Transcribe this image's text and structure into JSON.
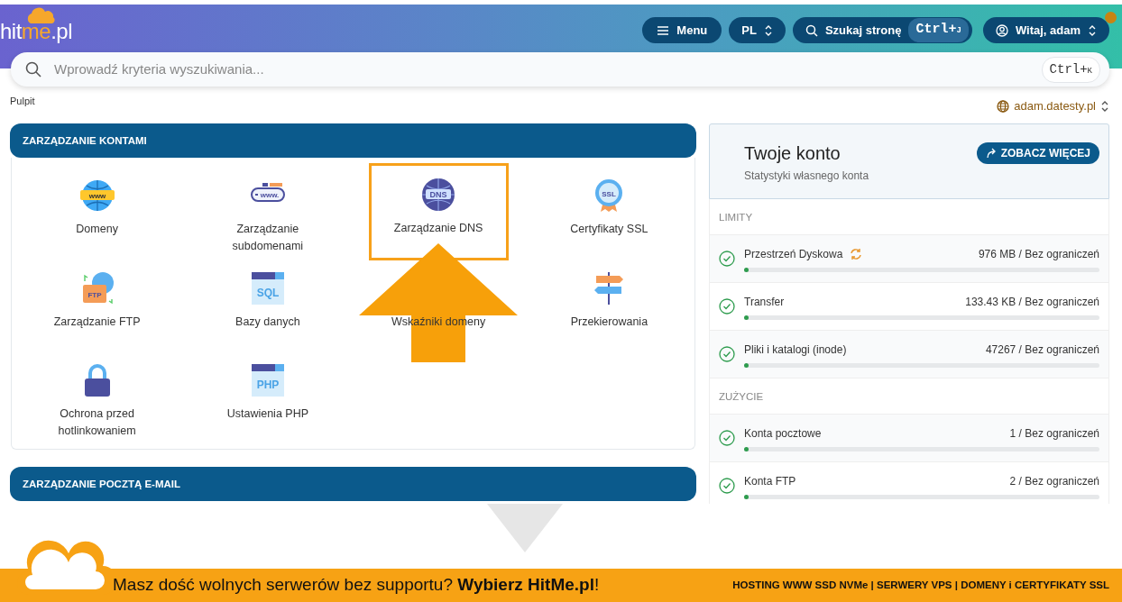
{
  "header": {
    "logo": {
      "text": "hit",
      "accent": "me",
      "suffix": ".pl"
    },
    "menu_button": "Menu",
    "language": "PL",
    "site_search": {
      "label": "Szukaj stronę",
      "shortcut": "Ctrl+",
      "key": "J"
    },
    "user_button": "Witaj, adam",
    "notification": true
  },
  "search": {
    "placeholder": "Wprowadź kryteria wyszukiwania...",
    "shortcut": "Ctrl+",
    "key": "K"
  },
  "breadcrumb": "Pulpit",
  "domain": "adam.datesty.pl",
  "sections": [
    {
      "title": "ZARZĄDZANIE KONTAMI",
      "items": [
        {
          "label": "Domeny",
          "icon_text": "www",
          "highlighted": false
        },
        {
          "label": "Zarządzanie subdomenami",
          "icon_text": "www.",
          "highlighted": false
        },
        {
          "label": "Zarządzanie DNS",
          "icon_text": "DNS",
          "highlighted": true
        },
        {
          "label": "Certyfikaty SSL",
          "icon_text": "SSL",
          "highlighted": false
        },
        {
          "label": "Zarządzanie FTP",
          "icon_text": "FTP",
          "highlighted": false
        },
        {
          "label": "Bazy danych",
          "icon_text": "SQL",
          "highlighted": false
        },
        {
          "label": "Wskaźniki domeny",
          "highlighted": false
        },
        {
          "label": "Przekierowania",
          "highlighted": false
        },
        {
          "label": "Ochrona przed hotlinkowaniem",
          "highlighted": false
        },
        {
          "label": "Ustawienia PHP",
          "icon_text": "PHP",
          "highlighted": false
        }
      ]
    },
    {
      "title": "ZARZĄDZANIE POCZTĄ E-MAIL"
    }
  ],
  "account": {
    "title": "Twoje konto",
    "subtitle": "Statystyki własnego konta",
    "button": "ZOBACZ WIĘCEJ",
    "groups": [
      {
        "title": "LIMITY",
        "rows": [
          {
            "label": "Przestrzeń Dyskowa",
            "value": "976 MB / Bez ograniczeń",
            "level": 0.01,
            "refresh": true
          },
          {
            "label": "Transfer",
            "value": "133.43 KB / Bez ograniczeń",
            "level": 0.01,
            "refresh": false
          },
          {
            "label": "Pliki i katalogi (inode)",
            "value": "47267 / Bez ograniczeń",
            "level": 0.01,
            "refresh": false
          }
        ]
      },
      {
        "title": "ZUŻYCIE",
        "rows": [
          {
            "label": "Konta pocztowe",
            "value": "1 / Bez ograniczeń",
            "level": 0.01,
            "refresh": false
          },
          {
            "label": "Konta FTP",
            "value": "2 / Bez ograniczeń",
            "level": 0.01,
            "refresh": false
          }
        ]
      }
    ]
  },
  "banner": {
    "text": "Masz dość wolnych serwerów bez supportu? **Wybierz HitMe.pl**!",
    "tagline": "HOSTING WWW SSD NVMe | SERWERY VPS | DOMENY i CERTYFIKATY SSL"
  }
}
